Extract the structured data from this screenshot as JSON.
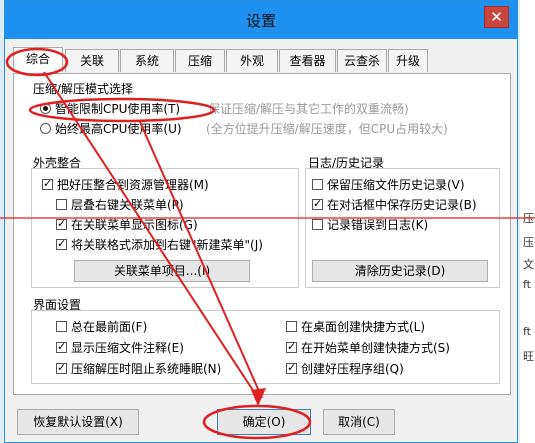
{
  "window": {
    "title": "设置",
    "close_label": "✕"
  },
  "tabs": [
    {
      "label": "综合",
      "active": true
    },
    {
      "label": "关联"
    },
    {
      "label": "系统"
    },
    {
      "label": "压缩"
    },
    {
      "label": "外观"
    },
    {
      "label": "查看器"
    },
    {
      "label": "云查杀"
    },
    {
      "label": "升级"
    }
  ],
  "mode": {
    "title": "压缩/解压模式选择",
    "options": [
      {
        "label": "智能限制CPU使用率(T)",
        "desc": "保证压缩/解压与其它工作的双重流畅)",
        "selected": true
      },
      {
        "label": "始终最高CPU使用率(U)",
        "desc": "(全方位提升压缩/解压速度，但CPU占用较大)",
        "selected": false
      }
    ]
  },
  "shell": {
    "title": "外壳整合",
    "items": [
      {
        "label": "把好压整合到资源管理器(M)",
        "checked": true
      },
      {
        "label": "层叠右键关联菜单(P)",
        "checked": false
      },
      {
        "label": "在关联菜单显示图标(G)",
        "checked": true
      },
      {
        "label": "将关联格式添加到右键\"新建菜单\"(J)",
        "checked": true
      }
    ],
    "button": "关联菜单项目...(I)"
  },
  "log": {
    "title": "日志/历史记录",
    "items": [
      {
        "label": "保留压缩文件历史记录(V)",
        "checked": false
      },
      {
        "label": "在对话框中保存历史记录(B)",
        "checked": true
      },
      {
        "label": "记录错误到日志(K)",
        "checked": false
      }
    ],
    "button": "清除历史记录(D)"
  },
  "ui": {
    "title": "界面设置",
    "left": [
      {
        "label": "总在最前面(F)",
        "checked": false
      },
      {
        "label": "显示压缩文件注释(E)",
        "checked": true
      },
      {
        "label": "压缩解压时阻止系统睡眠(N)",
        "checked": true
      }
    ],
    "right": [
      {
        "label": "在桌面创建快捷方式(L)",
        "checked": false
      },
      {
        "label": "在开始菜单创建快捷方式(S)",
        "checked": true
      },
      {
        "label": "创建好压程序组(Q)",
        "checked": true
      }
    ]
  },
  "footer": {
    "restore": "恢复默认设置(X)",
    "ok": "确定(O)",
    "cancel": "取消(C)"
  },
  "background_text": [
    "压",
    "压",
    "文",
    "ft",
    "ft",
    "旺"
  ],
  "annotation_color": "#e02020"
}
